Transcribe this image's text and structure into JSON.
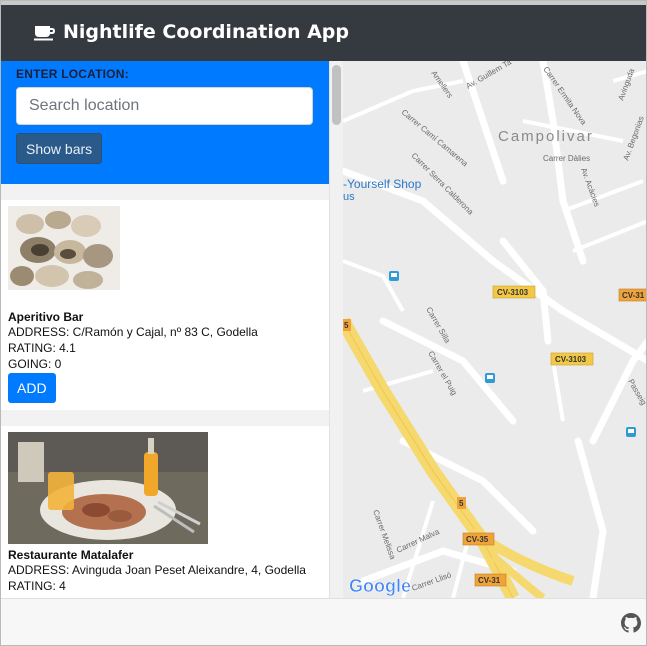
{
  "app": {
    "title": "Nightlife Coordination App"
  },
  "search": {
    "label": "ENTER LOCATION:",
    "placeholder": "Search location",
    "button_label": "Show bars"
  },
  "bars": [
    {
      "name": "Aperitivo Bar",
      "address": "ADDRESS: C/Ramón y Cajal, nº 83 C, Godella",
      "rating": "RATING: 4.1",
      "going": "GOING: 0",
      "add_label": "ADD"
    },
    {
      "name": "Restaurante Matalafer",
      "address": "ADDRESS: Avinguda Joan Peset Aleixandre, 4, Godella",
      "rating": "RATING: 4"
    }
  ],
  "map": {
    "area_label": "Campolivar",
    "shop_label": "-Yourself Shop",
    "shop_label_2": "us",
    "streets": [
      "Amellers",
      "Av. Guillem Ta",
      "Carrer Ermita Nova",
      "Carrer Camí Camarena",
      "Carrer Serra Calderona",
      "Carrer Dàlies",
      "Av. Acàcies",
      "Avinguda",
      "Av. Begonias",
      "Carrer Silla",
      "Carrer el Puig",
      "Carrer Melissa",
      "Carrer Malva",
      "Carrer Llisó",
      "Passeig"
    ],
    "road_badges": [
      "CV-3103",
      "CV-3103",
      "CV-31",
      "CV-35",
      "CV-31",
      "5",
      "5"
    ],
    "provider": "Google"
  }
}
